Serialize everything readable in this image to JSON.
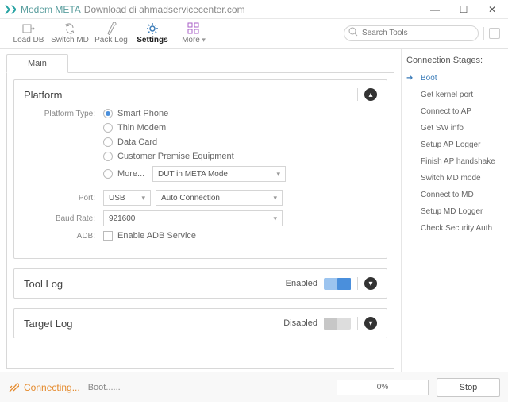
{
  "window": {
    "title": "Modem META",
    "subtitle": "Download di ahmadservicecenter.com"
  },
  "toolbar": {
    "items": [
      "Load DB",
      "Switch MD",
      "Pack Log",
      "Settings",
      "More"
    ],
    "search_placeholder": "Search Tools"
  },
  "tabs": {
    "main": "Main"
  },
  "platform_panel": {
    "title": "Platform",
    "type_label": "Platform Type:",
    "types": [
      "Smart Phone",
      "Thin Modem",
      "Data Card",
      "Customer Premise Equipment",
      "More..."
    ],
    "more_mode": "DUT in META Mode",
    "port_label": "Port:",
    "port_value": "USB",
    "port_mode": "Auto Connection",
    "baud_label": "Baud Rate:",
    "baud_value": "921600",
    "adb_label": "ADB:",
    "adb_option": "Enable ADB Service"
  },
  "tool_log": {
    "title": "Tool Log",
    "state": "Enabled"
  },
  "target_log": {
    "title": "Target Log",
    "state": "Disabled"
  },
  "stages": {
    "title": "Connection Stages:",
    "items": [
      "Boot",
      "Get kernel port",
      "Connect to AP",
      "Get SW info",
      "Setup AP Logger",
      "Finish AP handshake",
      "Switch MD mode",
      "Connect to MD",
      "Setup MD Logger",
      "Check Security Auth"
    ]
  },
  "status": {
    "connecting": "Connecting...",
    "boot": "Boot......",
    "progress": "0%",
    "stop": "Stop"
  }
}
